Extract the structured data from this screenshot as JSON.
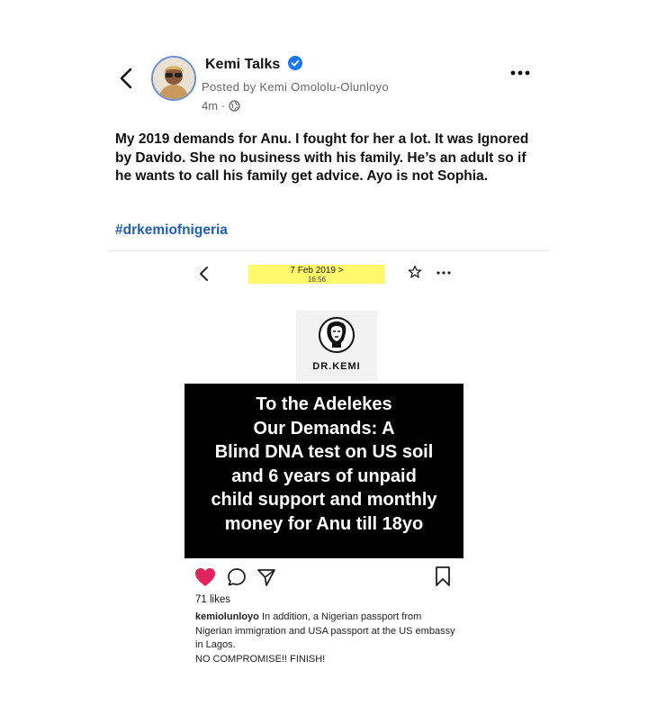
{
  "post": {
    "author": "Kemi Talks",
    "posted_by": "Posted by Kemi Omololu-Olunloyo",
    "time": "4m ·",
    "text": "My 2019 demands for Anu. I fought for her a lot. It was Ignored by Davido. She no business with his family. He’s an adult so if he wants to call his family get advice. Ayo is not Sophia.",
    "hashtag": "#drkemiofnigeria"
  },
  "embedded": {
    "date": "7 Feb 2019  >",
    "time": "16:56",
    "logo_text": "DR.KEMI",
    "panel_lines": [
      "To the Adelekes",
      "Our Demands: A",
      "Blind DNA test on US soil",
      "and 6 years of unpaid",
      "child support and monthly",
      "money for Anu till 18yo"
    ],
    "likes": "71 likes",
    "caption_user": "kemiolunloyo",
    "caption_text": " In addition, a Nigerian passport from Nigerian immigration and USA passport at the US embassy in Lagos.",
    "caption_line2": "NO COMPROMISE!! FINISH!",
    "highlight_color": "#fff86a",
    "heart_color": "#e0245e"
  }
}
